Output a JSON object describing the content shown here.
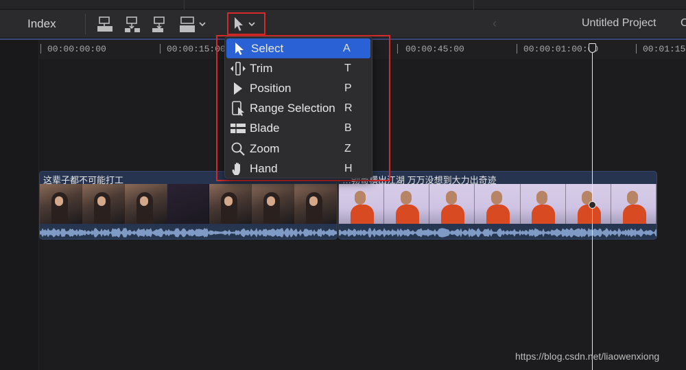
{
  "toolbar": {
    "index_label": "Index",
    "project_title": "Untitled Project",
    "trailing_text": "C"
  },
  "icons": {
    "tool": "pointer-arrow",
    "tool_chevron": "chevron-down",
    "back": "chevron-left",
    "edit_buttons": [
      "connect-clip",
      "insert-clip",
      "append-clip",
      "overwrite-clip"
    ]
  },
  "ruler": {
    "ticks": [
      "00:00:00:00",
      "00:00:15:00",
      "00:00:45:00",
      "00:00:01:00:00",
      "00:01:15"
    ]
  },
  "tool_menu": {
    "items": [
      {
        "label": "Select",
        "shortcut": "A",
        "icon": "select-arrow",
        "selected": true
      },
      {
        "label": "Trim",
        "shortcut": "T",
        "icon": "trim-bracket",
        "selected": false
      },
      {
        "label": "Position",
        "shortcut": "P",
        "icon": "position-arrow",
        "selected": false
      },
      {
        "label": "Range Selection",
        "shortcut": "R",
        "icon": "range-selection",
        "selected": false
      },
      {
        "label": "Blade",
        "shortcut": "B",
        "icon": "blade",
        "selected": false
      },
      {
        "label": "Zoom",
        "shortcut": "Z",
        "icon": "magnifier",
        "selected": false
      },
      {
        "label": "Hand",
        "shortcut": "H",
        "icon": "hand",
        "selected": false
      }
    ]
  },
  "clips": [
    {
      "name": "这辈子都不可能打工",
      "frames": 7
    },
    {
      "name": "…勃哥横出江湖 万万没想到大力出奇迹",
      "frames": 7
    }
  ],
  "watermark": "https://blog.csdn.net/liaowenxiong",
  "colors": {
    "highlight": "#2a62d6",
    "annotation_red": "#d82a2a",
    "clip_blue": "#26344f"
  }
}
